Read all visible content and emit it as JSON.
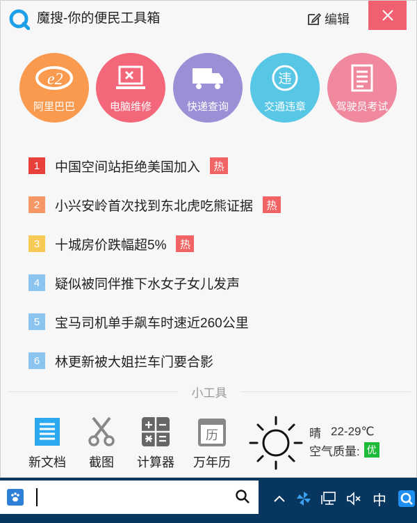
{
  "window": {
    "title": "魔搜-你的便民工具箱",
    "edit_label": "编辑"
  },
  "shortcuts": [
    {
      "label": "阿里巴巴",
      "icon": "alibaba-icon",
      "color": "#f99a4f"
    },
    {
      "label": "电脑维修",
      "icon": "laptop-repair-icon",
      "color": "#f4677a"
    },
    {
      "label": "快递查询",
      "icon": "delivery-truck-icon",
      "color": "#9b8fd6"
    },
    {
      "label": "交通违章",
      "icon": "traffic-violation-icon",
      "color": "#57c7e5"
    },
    {
      "label": "驾驶员考试",
      "icon": "exam-document-icon",
      "color": "#f0889e"
    }
  ],
  "news": [
    {
      "rank": "1",
      "text": "中国空间站拒绝美国加入",
      "hot": "热",
      "rank_color": "#e8413b"
    },
    {
      "rank": "2",
      "text": "小兴安岭首次找到东北虎吃熊证据",
      "hot": "热",
      "rank_color": "#f69765"
    },
    {
      "rank": "3",
      "text": "十城房价跌幅超5%",
      "hot": "热",
      "rank_color": "#f7c955"
    },
    {
      "rank": "4",
      "text": "疑似被同伴推下水女子女儿发声",
      "hot": "",
      "rank_color": "#8cc4f0"
    },
    {
      "rank": "5",
      "text": "宝马司机单手飙车时速近260公里",
      "hot": "",
      "rank_color": "#8cc4f0"
    },
    {
      "rank": "6",
      "text": "林更新被大姐拦车门要合影",
      "hot": "",
      "rank_color": "#8cc4f0"
    }
  ],
  "tools": {
    "heading": "小工具",
    "items": [
      {
        "label": "新文档",
        "icon": "new-document-icon"
      },
      {
        "label": "截图",
        "icon": "scissors-icon"
      },
      {
        "label": "计算器",
        "icon": "calculator-icon"
      },
      {
        "label": "万年历",
        "icon": "calendar-icon"
      }
    ],
    "calendar_glyph": "历"
  },
  "weather": {
    "condition": "晴",
    "temperature": "22-29℃",
    "air_quality_label": "空气质量:",
    "air_quality_value": "优",
    "icon": "sun-icon"
  },
  "taskbar": {
    "input_icon": "baidu-paw-icon",
    "tray_ime": "中",
    "tray_items": [
      "chevron-up-icon",
      "pinwheel-icon",
      "network-icon",
      "volume-mute-icon",
      "ime-label",
      "search-app-icon"
    ]
  }
}
